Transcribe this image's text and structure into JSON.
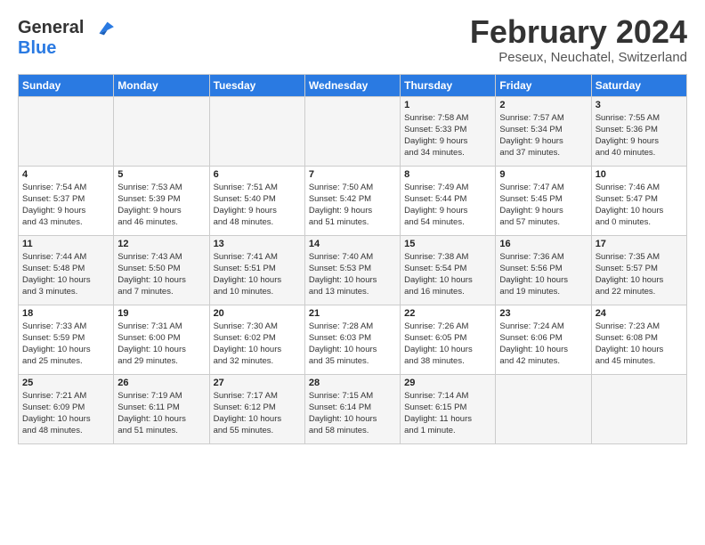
{
  "header": {
    "logo_line1": "General",
    "logo_line2": "Blue",
    "title": "February 2024",
    "subtitle": "Peseux, Neuchatel, Switzerland"
  },
  "days_of_week": [
    "Sunday",
    "Monday",
    "Tuesday",
    "Wednesday",
    "Thursday",
    "Friday",
    "Saturday"
  ],
  "weeks": [
    [
      {
        "day": "",
        "info": ""
      },
      {
        "day": "",
        "info": ""
      },
      {
        "day": "",
        "info": ""
      },
      {
        "day": "",
        "info": ""
      },
      {
        "day": "1",
        "info": "Sunrise: 7:58 AM\nSunset: 5:33 PM\nDaylight: 9 hours\nand 34 minutes."
      },
      {
        "day": "2",
        "info": "Sunrise: 7:57 AM\nSunset: 5:34 PM\nDaylight: 9 hours\nand 37 minutes."
      },
      {
        "day": "3",
        "info": "Sunrise: 7:55 AM\nSunset: 5:36 PM\nDaylight: 9 hours\nand 40 minutes."
      }
    ],
    [
      {
        "day": "4",
        "info": "Sunrise: 7:54 AM\nSunset: 5:37 PM\nDaylight: 9 hours\nand 43 minutes."
      },
      {
        "day": "5",
        "info": "Sunrise: 7:53 AM\nSunset: 5:39 PM\nDaylight: 9 hours\nand 46 minutes."
      },
      {
        "day": "6",
        "info": "Sunrise: 7:51 AM\nSunset: 5:40 PM\nDaylight: 9 hours\nand 48 minutes."
      },
      {
        "day": "7",
        "info": "Sunrise: 7:50 AM\nSunset: 5:42 PM\nDaylight: 9 hours\nand 51 minutes."
      },
      {
        "day": "8",
        "info": "Sunrise: 7:49 AM\nSunset: 5:44 PM\nDaylight: 9 hours\nand 54 minutes."
      },
      {
        "day": "9",
        "info": "Sunrise: 7:47 AM\nSunset: 5:45 PM\nDaylight: 9 hours\nand 57 minutes."
      },
      {
        "day": "10",
        "info": "Sunrise: 7:46 AM\nSunset: 5:47 PM\nDaylight: 10 hours\nand 0 minutes."
      }
    ],
    [
      {
        "day": "11",
        "info": "Sunrise: 7:44 AM\nSunset: 5:48 PM\nDaylight: 10 hours\nand 3 minutes."
      },
      {
        "day": "12",
        "info": "Sunrise: 7:43 AM\nSunset: 5:50 PM\nDaylight: 10 hours\nand 7 minutes."
      },
      {
        "day": "13",
        "info": "Sunrise: 7:41 AM\nSunset: 5:51 PM\nDaylight: 10 hours\nand 10 minutes."
      },
      {
        "day": "14",
        "info": "Sunrise: 7:40 AM\nSunset: 5:53 PM\nDaylight: 10 hours\nand 13 minutes."
      },
      {
        "day": "15",
        "info": "Sunrise: 7:38 AM\nSunset: 5:54 PM\nDaylight: 10 hours\nand 16 minutes."
      },
      {
        "day": "16",
        "info": "Sunrise: 7:36 AM\nSunset: 5:56 PM\nDaylight: 10 hours\nand 19 minutes."
      },
      {
        "day": "17",
        "info": "Sunrise: 7:35 AM\nSunset: 5:57 PM\nDaylight: 10 hours\nand 22 minutes."
      }
    ],
    [
      {
        "day": "18",
        "info": "Sunrise: 7:33 AM\nSunset: 5:59 PM\nDaylight: 10 hours\nand 25 minutes."
      },
      {
        "day": "19",
        "info": "Sunrise: 7:31 AM\nSunset: 6:00 PM\nDaylight: 10 hours\nand 29 minutes."
      },
      {
        "day": "20",
        "info": "Sunrise: 7:30 AM\nSunset: 6:02 PM\nDaylight: 10 hours\nand 32 minutes."
      },
      {
        "day": "21",
        "info": "Sunrise: 7:28 AM\nSunset: 6:03 PM\nDaylight: 10 hours\nand 35 minutes."
      },
      {
        "day": "22",
        "info": "Sunrise: 7:26 AM\nSunset: 6:05 PM\nDaylight: 10 hours\nand 38 minutes."
      },
      {
        "day": "23",
        "info": "Sunrise: 7:24 AM\nSunset: 6:06 PM\nDaylight: 10 hours\nand 42 minutes."
      },
      {
        "day": "24",
        "info": "Sunrise: 7:23 AM\nSunset: 6:08 PM\nDaylight: 10 hours\nand 45 minutes."
      }
    ],
    [
      {
        "day": "25",
        "info": "Sunrise: 7:21 AM\nSunset: 6:09 PM\nDaylight: 10 hours\nand 48 minutes."
      },
      {
        "day": "26",
        "info": "Sunrise: 7:19 AM\nSunset: 6:11 PM\nDaylight: 10 hours\nand 51 minutes."
      },
      {
        "day": "27",
        "info": "Sunrise: 7:17 AM\nSunset: 6:12 PM\nDaylight: 10 hours\nand 55 minutes."
      },
      {
        "day": "28",
        "info": "Sunrise: 7:15 AM\nSunset: 6:14 PM\nDaylight: 10 hours\nand 58 minutes."
      },
      {
        "day": "29",
        "info": "Sunrise: 7:14 AM\nSunset: 6:15 PM\nDaylight: 11 hours\nand 1 minute."
      },
      {
        "day": "",
        "info": ""
      },
      {
        "day": "",
        "info": ""
      }
    ]
  ]
}
